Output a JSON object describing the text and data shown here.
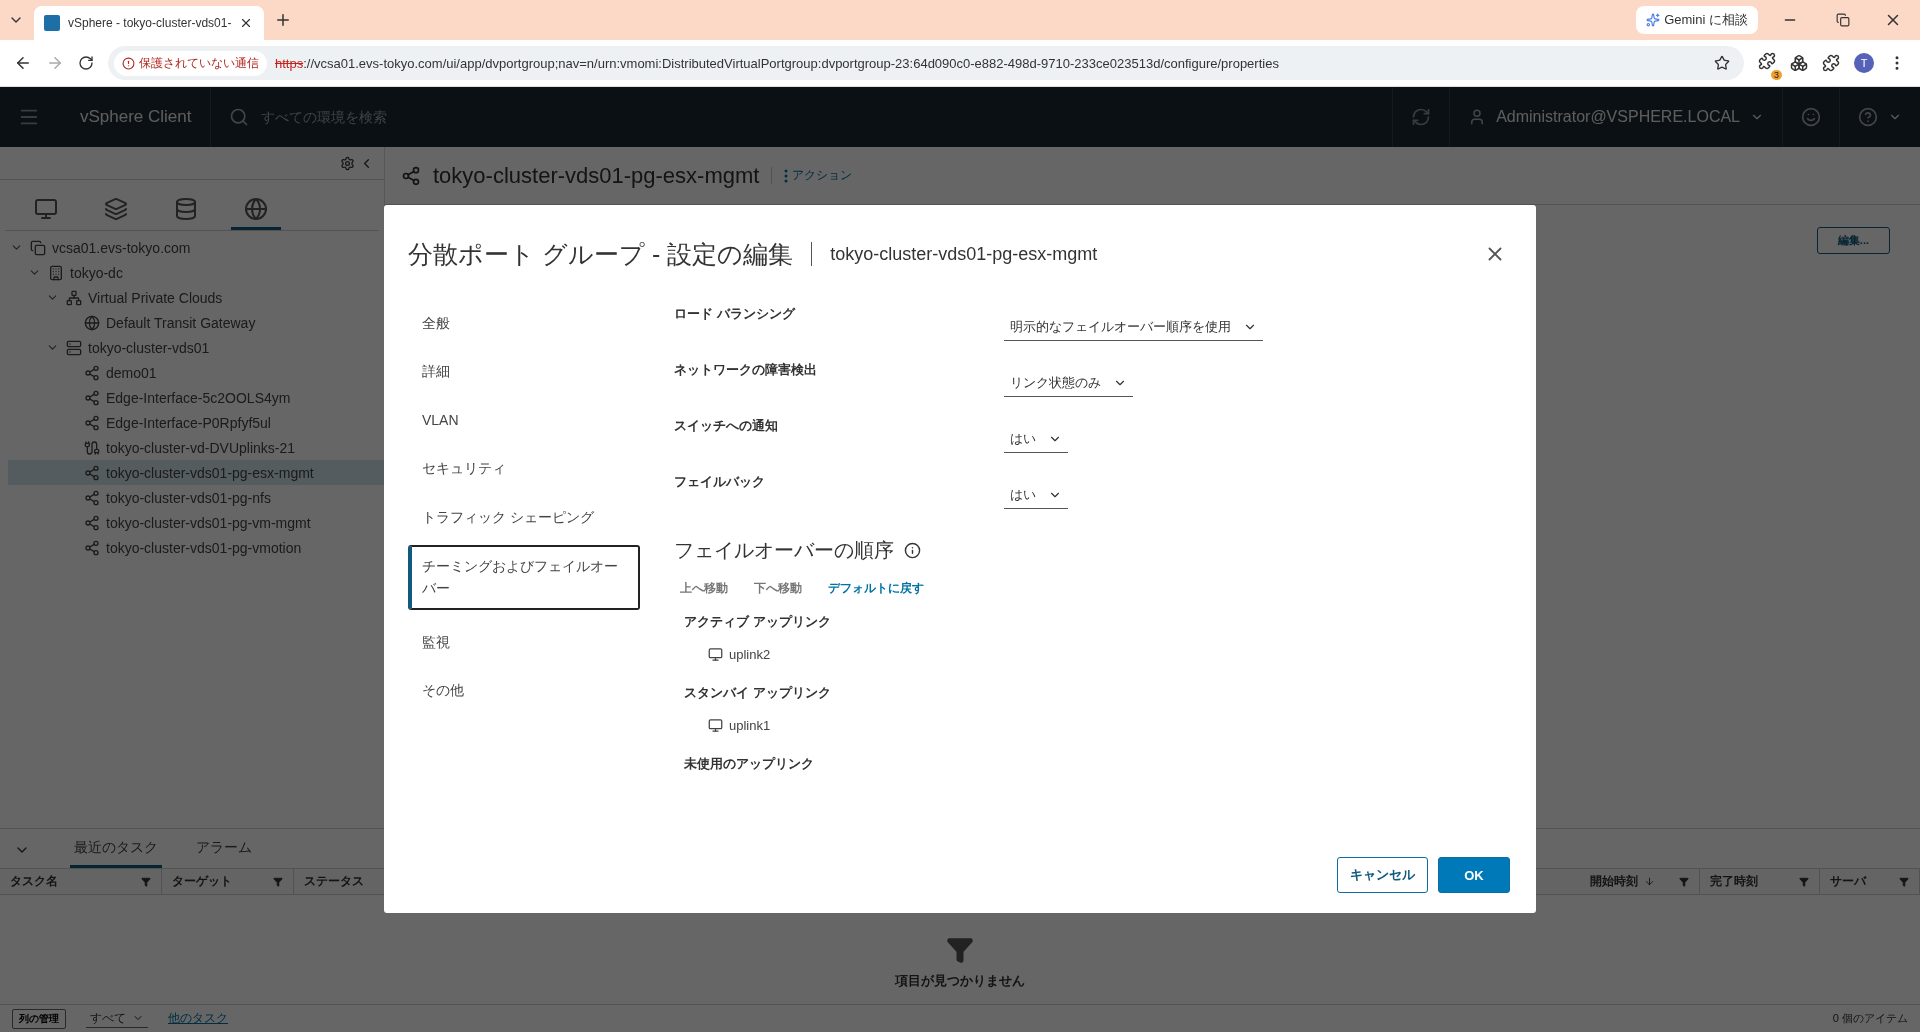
{
  "browser": {
    "tab_title": "vSphere - tokyo-cluster-vds01-",
    "gemini_button": "Gemini に相談",
    "security_badge": "保護されていない通信",
    "url_scheme": "https",
    "url_rest": "://vcsa01.evs-tokyo.com/ui/app/dvportgroup;nav=n/urn:vmomi:DistributedVirtualPortgroup:dvportgroup-23:64d090c0-e882-498d-9710-233ce023513d/configure/properties",
    "extension_badge": "3",
    "avatar": "T"
  },
  "header": {
    "app_name": "vSphere Client",
    "search": {
      "placeholder": "すべての環境を検索"
    },
    "user": "Administrator@VSPHERE.LOCAL"
  },
  "nav_tabs": [
    {
      "kind": "hosts",
      "selected": false
    },
    {
      "kind": "vms",
      "selected": false
    },
    {
      "kind": "storage",
      "selected": false
    },
    {
      "kind": "network",
      "selected": true
    }
  ],
  "tree": [
    {
      "label": "vcsa01.evs-tokyo.com",
      "kind": "vcenter",
      "expanded": true,
      "selected": false,
      "children": [
        {
          "label": "tokyo-dc",
          "kind": "datacenter",
          "expanded": true,
          "selected": false,
          "children": [
            {
              "label": "Virtual Private Clouds",
              "kind": "vpc",
              "expanded": true,
              "selected": false,
              "children": [
                {
                  "label": "Default Transit Gateway",
                  "kind": "gateway",
                  "selected": false
                }
              ]
            },
            {
              "label": "tokyo-cluster-vds01",
              "kind": "switch",
              "expanded": true,
              "selected": false,
              "children": [
                {
                  "label": "demo01",
                  "kind": "portgroup",
                  "selected": false
                },
                {
                  "label": "Edge-Interface-5c2OOLS4ym",
                  "kind": "portgroup",
                  "selected": false
                },
                {
                  "label": "Edge-Interface-P0Rpfyf5ul",
                  "kind": "portgroup",
                  "selected": false
                },
                {
                  "label": "tokyo-cluster-vd-DVUplinks-21",
                  "kind": "uplinks",
                  "selected": false
                },
                {
                  "label": "tokyo-cluster-vds01-pg-esx-mgmt",
                  "kind": "portgroup",
                  "selected": true
                },
                {
                  "label": "tokyo-cluster-vds01-pg-nfs",
                  "kind": "portgroup",
                  "selected": false
                },
                {
                  "label": "tokyo-cluster-vds01-pg-vm-mgmt",
                  "kind": "portgroup",
                  "selected": false
                },
                {
                  "label": "tokyo-cluster-vds01-pg-vmotion",
                  "kind": "portgroup",
                  "selected": false
                }
              ]
            }
          ]
        }
      ]
    }
  ],
  "content": {
    "title": "tokyo-cluster-vds01-pg-esx-mgmt",
    "actions": "アクション",
    "edit_button": "編集..."
  },
  "tasks": {
    "tabs": [
      {
        "label": "最近のタスク",
        "selected": true
      },
      {
        "label": "アラーム",
        "selected": false
      }
    ],
    "columns_left": [
      {
        "label": "タスク名",
        "sorted": false
      },
      {
        "label": "ターゲット",
        "sorted": false
      },
      {
        "label": "ステータス",
        "sorted": false
      }
    ],
    "columns_right": [
      {
        "label": "開始時刻",
        "sorted": true
      },
      {
        "label": "完了時刻",
        "sorted": false
      },
      {
        "label": "サーバ",
        "sorted": false
      }
    ],
    "empty": "項目が見つかりません",
    "manage_columns": "列の管理",
    "filter": "すべて",
    "more_tasks": "他のタスク",
    "count": "0 個のアイテム"
  },
  "dialog": {
    "title": "分散ポート グループ - 設定の編集",
    "subtitle": "tokyo-cluster-vds01-pg-esx-mgmt",
    "nav": [
      {
        "label": "全般",
        "selected": false
      },
      {
        "label": "詳細",
        "selected": false
      },
      {
        "label": "VLAN",
        "selected": false
      },
      {
        "label": "セキュリティ",
        "selected": false
      },
      {
        "label": "トラフィック シェーピング",
        "selected": false
      },
      {
        "label": "チーミングおよびフェイルオーバー",
        "selected": true
      },
      {
        "label": "監視",
        "selected": false
      },
      {
        "label": "その他",
        "selected": false
      }
    ],
    "settings": [
      {
        "label": "ロード バランシング",
        "value": "明示的なフェイルオーバー順序を使用"
      },
      {
        "label": "ネットワークの障害検出",
        "value": "リンク状態のみ"
      },
      {
        "label": "スイッチへの通知",
        "value": "はい"
      },
      {
        "label": "フェイルバック",
        "value": "はい"
      }
    ],
    "failover_title": "フェイルオーバーの順序",
    "order_actions": [
      {
        "label": "上へ移動",
        "disabled": true
      },
      {
        "label": "下へ移動",
        "disabled": true
      },
      {
        "label": "デフォルトに戻す",
        "disabled": false
      }
    ],
    "groups": [
      {
        "heading": "アクティブ アップリンク",
        "uplinks": [
          "uplink2"
        ]
      },
      {
        "heading": "スタンバイ アップリンク",
        "uplinks": [
          "uplink1"
        ]
      },
      {
        "heading": "未使用のアップリンク"
      }
    ],
    "buttons": [
      {
        "label": "キャンセル",
        "kind": "secondary"
      },
      {
        "label": "OK",
        "kind": "primary"
      }
    ]
  }
}
